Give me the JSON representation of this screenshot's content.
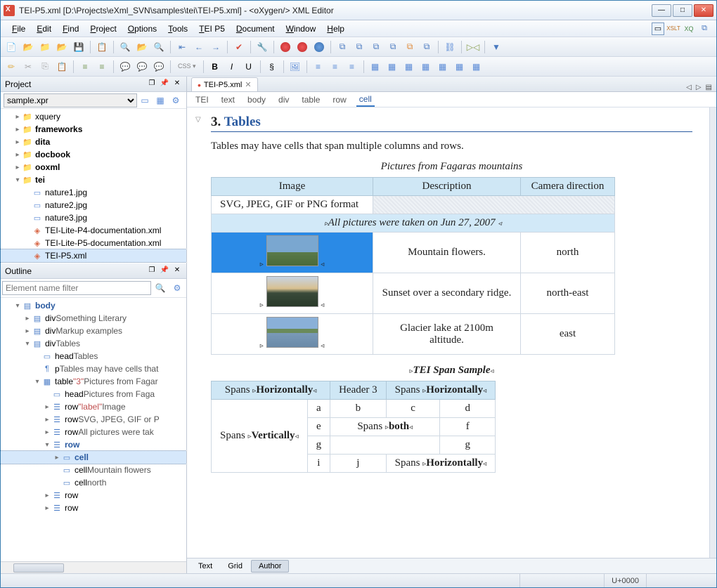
{
  "title": "TEI-P5.xml [D:\\Projects\\eXml_SVN\\samples\\tei\\TEI-P5.xml] - <oXygen/> XML Editor",
  "menus": [
    "File",
    "Edit",
    "Find",
    "Project",
    "Options",
    "Tools",
    "TEI P5",
    "Document",
    "Window",
    "Help"
  ],
  "project": {
    "title": "Project",
    "sample": "sample.xpr",
    "items": [
      {
        "type": "folder",
        "label": "xquery",
        "exp": 0,
        "d": 1
      },
      {
        "type": "folder",
        "label": "frameworks",
        "exp": 0,
        "bold": 1,
        "d": 1
      },
      {
        "type": "folder",
        "label": "dita",
        "exp": 0,
        "bold": 1,
        "d": 1
      },
      {
        "type": "folder",
        "label": "docbook",
        "exp": 0,
        "bold": 1,
        "d": 1
      },
      {
        "type": "folder",
        "label": "ooxml",
        "exp": 0,
        "bold": 1,
        "d": 1
      },
      {
        "type": "folder",
        "label": "tei",
        "exp": 1,
        "bold": 1,
        "d": 1
      },
      {
        "type": "file",
        "label": "nature1.jpg",
        "icon": "img",
        "d": 2
      },
      {
        "type": "file",
        "label": "nature2.jpg",
        "icon": "img",
        "d": 2
      },
      {
        "type": "file",
        "label": "nature3.jpg",
        "icon": "img",
        "d": 2
      },
      {
        "type": "file",
        "label": "TEI-Lite-P4-documentation.xml",
        "icon": "xml",
        "d": 2
      },
      {
        "type": "file",
        "label": "TEI-Lite-P5-documentation.xml",
        "icon": "xml",
        "d": 2
      },
      {
        "type": "file",
        "label": "TEI-P5.xml",
        "icon": "xml",
        "d": 2,
        "sel": 1
      }
    ]
  },
  "outline": {
    "title": "Outline",
    "filter_placeholder": "Element name filter",
    "items": [
      {
        "d": 1,
        "tw": "▾",
        "icon": "el",
        "label": "body",
        "blue": 1
      },
      {
        "d": 2,
        "tw": "▸",
        "icon": "el",
        "label": "div",
        "txt": "Something Literary"
      },
      {
        "d": 2,
        "tw": "▸",
        "icon": "el",
        "label": "div",
        "txt": "Markup examples"
      },
      {
        "d": 2,
        "tw": "▾",
        "icon": "el",
        "label": "div",
        "txt": "Tables"
      },
      {
        "d": 3,
        "tw": "",
        "icon": "hd",
        "label": "head",
        "txt": "Tables"
      },
      {
        "d": 3,
        "tw": "",
        "icon": "p",
        "label": "p",
        "txt": "Tables may have cells that"
      },
      {
        "d": 3,
        "tw": "▾",
        "icon": "tb",
        "label": "table",
        "attr": "\"3\"",
        "txt": "Pictures from Fagar"
      },
      {
        "d": 4,
        "tw": "",
        "icon": "hd",
        "label": "head",
        "txt": "Pictures from Faga"
      },
      {
        "d": 4,
        "tw": "▸",
        "icon": "rw",
        "label": "row",
        "attr": "\"label\"",
        "txt": "Image"
      },
      {
        "d": 4,
        "tw": "▸",
        "icon": "rw",
        "label": "row",
        "txt": "SVG, JPEG, GIF or P"
      },
      {
        "d": 4,
        "tw": "▸",
        "icon": "rw",
        "label": "row",
        "txt": "All pictures were tak"
      },
      {
        "d": 4,
        "tw": "▾",
        "icon": "rw",
        "label": "row",
        "blue": 1
      },
      {
        "d": 5,
        "tw": "▸",
        "icon": "cl",
        "label": "cell",
        "sel": 1,
        "blue": 1
      },
      {
        "d": 5,
        "tw": "",
        "icon": "cl",
        "label": "cell",
        "txt": "Mountain flowers"
      },
      {
        "d": 5,
        "tw": "",
        "icon": "cl",
        "label": "cell",
        "txt": "north"
      },
      {
        "d": 4,
        "tw": "▸",
        "icon": "rw",
        "label": "row"
      },
      {
        "d": 4,
        "tw": "▸",
        "icon": "rw",
        "label": "row"
      }
    ]
  },
  "tab": {
    "name": "TEI-P5.xml",
    "modified": true
  },
  "breadcrumb": [
    "TEI",
    "text",
    "body",
    "div",
    "table",
    "row",
    "cell"
  ],
  "content": {
    "section_num": "3.",
    "section_title": "Tables",
    "intro": "Tables may have cells that span multiple columns and rows.",
    "table1": {
      "caption": "Pictures from Fagaras mountains",
      "headers": [
        "Image",
        "Description",
        "Camera direction"
      ],
      "format_row": "SVG, JPEG, GIF or PNG format",
      "note": "All pictures were taken on Jun 27, 2007",
      "rows": [
        {
          "img": "mtn",
          "desc": "Mountain flowers.",
          "dir": "north",
          "sel": 1
        },
        {
          "img": "sunset",
          "desc": "Sunset over a secondary ridge.",
          "dir": "north-east"
        },
        {
          "img": "lake",
          "desc": "Glacier lake at 2100m altitude.",
          "dir": "east"
        }
      ]
    },
    "table2": {
      "caption": "TEI Span Sample",
      "h": [
        "Spans ",
        "Horizontally",
        "Header 3",
        "Spans ",
        "Horizontally"
      ],
      "r1": [
        "Spans ",
        "Vertically",
        "a",
        "b",
        "c",
        "d"
      ],
      "r2": [
        "e",
        "Spans ",
        "both",
        "f"
      ],
      "r3": [
        "g",
        "g"
      ],
      "r4": [
        "i",
        "j",
        "Spans ",
        "Horizontally"
      ]
    }
  },
  "bottom_tabs": [
    "Text",
    "Grid",
    "Author"
  ],
  "status_unicode": "U+0000"
}
